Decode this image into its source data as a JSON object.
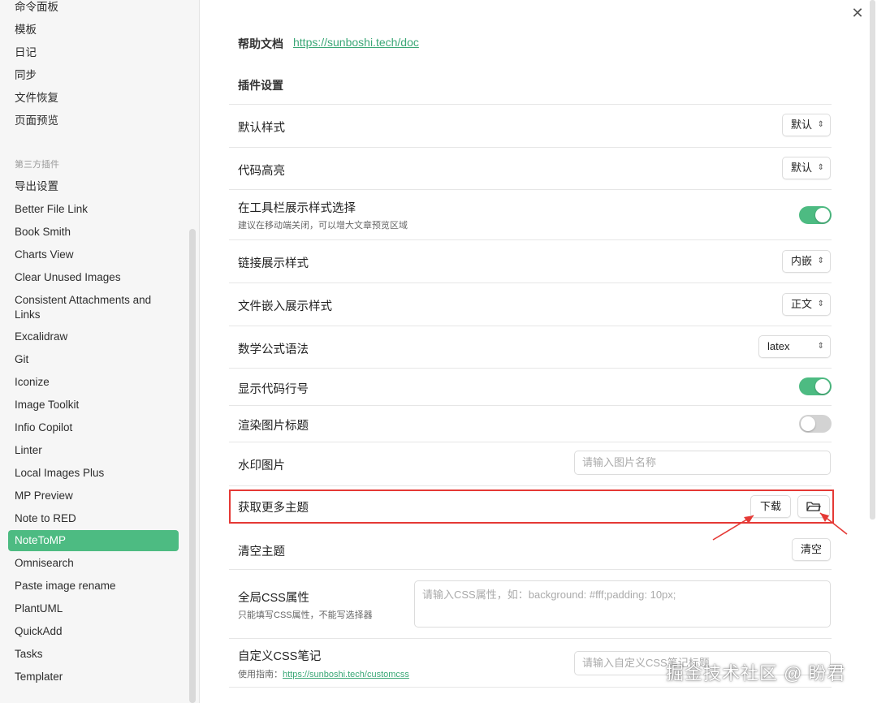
{
  "sidebar": {
    "core_items": [
      "命令面板",
      "模板",
      "日记",
      "同步",
      "文件恢复",
      "页面预览"
    ],
    "group_title": "第三方插件",
    "plugin_items": [
      "导出设置",
      "Better File Link",
      "Book Smith",
      "Charts View",
      "Clear Unused Images",
      "Consistent Attachments and\nLinks",
      "Excalidraw",
      "Git",
      "Iconize",
      "Image Toolkit",
      "Infio Copilot",
      "Linter",
      "Local Images Plus",
      "MP Preview",
      "Note to RED",
      "NoteToMP",
      "Omnisearch",
      "Paste image rename",
      "PlantUML",
      "QuickAdd",
      "Tasks",
      "Templater"
    ],
    "active_item": "NoteToMP"
  },
  "header": {
    "close_icon": "close-icon",
    "help_label": "帮助文档",
    "help_link": "https://sunboshi.tech/doc"
  },
  "section_title": "插件设置",
  "settings": {
    "default_style": {
      "label": "默认样式",
      "value": "默认"
    },
    "code_highlight": {
      "label": "代码高亮",
      "value": "默认"
    },
    "toolbar_style": {
      "label": "在工具栏展示样式选择",
      "desc": "建议在移动端关闭，可以增大文章预览区域",
      "enabled": true
    },
    "link_style": {
      "label": "链接展示样式",
      "value": "内嵌"
    },
    "embed_style": {
      "label": "文件嵌入展示样式",
      "value": "正文"
    },
    "math_syntax": {
      "label": "数学公式语法",
      "value": "latex"
    },
    "show_line_numbers": {
      "label": "显示代码行号",
      "enabled": true
    },
    "render_image_title": {
      "label": "渲染图片标题",
      "enabled": false
    },
    "watermark": {
      "label": "水印图片",
      "placeholder": "请输入图片名称"
    },
    "more_themes": {
      "label": "获取更多主题",
      "download_label": "下载",
      "folder_icon": "folder-icon"
    },
    "clear_theme": {
      "label": "清空主题",
      "button_label": "清空"
    },
    "global_css": {
      "label": "全局CSS属性",
      "desc": "只能填写CSS属性，不能写选择器",
      "placeholder": "请输入CSS属性，如：background: #fff;padding: 10px;"
    },
    "custom_css": {
      "label": "自定义CSS笔记",
      "desc_prefix": "使用指南：",
      "desc_link": "https://sunboshi.tech/customcss",
      "placeholder": "请输入自定义CSS笔记标题"
    }
  },
  "watermark_text": "掘金技术社区 @ 盼君",
  "colors": {
    "accent": "#4dbb82",
    "highlight_border": "#e53935",
    "link": "#3aa776"
  }
}
